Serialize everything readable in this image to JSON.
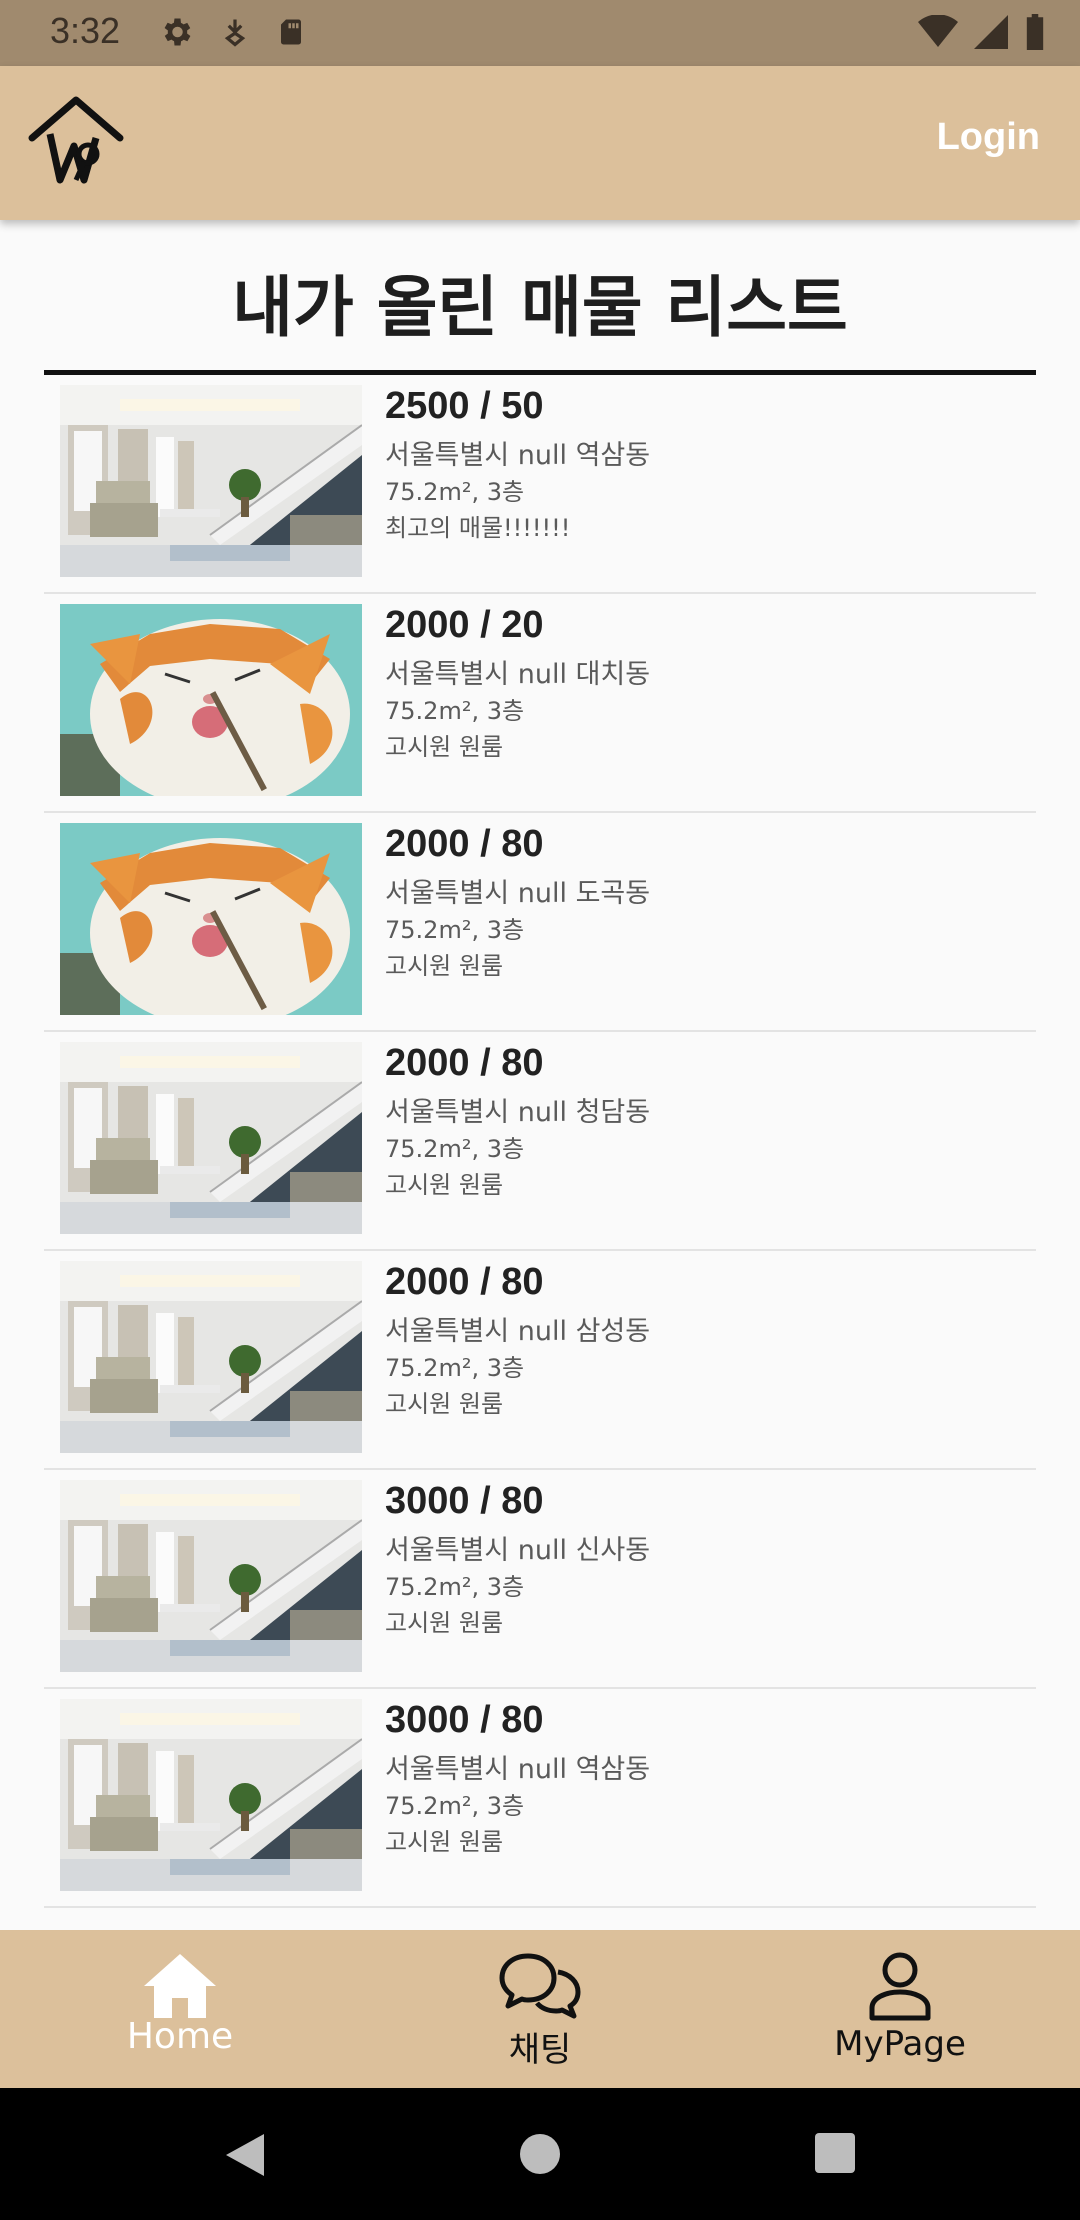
{
  "status_bar": {
    "time": "3:32",
    "icons_left": [
      "gear-icon",
      "download-icon",
      "sd-card-icon"
    ],
    "icons_right": [
      "wifi-icon",
      "signal-icon",
      "battery-icon"
    ]
  },
  "app_bar": {
    "logo": "house-key-logo",
    "login_label": "Login"
  },
  "page": {
    "title": "내가 올린 매물 리스트"
  },
  "listings": [
    {
      "thumb": "living-room-photo",
      "price": "2500 / 50",
      "address": "서울특별시 null 역삼동",
      "size": "75.2m², 3층",
      "desc": "최고의 매물!!!!!!!"
    },
    {
      "thumb": "cat-photo",
      "price": "2000 / 20",
      "address": "서울특별시 null 대치동",
      "size": "75.2m², 3층",
      "desc": "고시원 원룸"
    },
    {
      "thumb": "cat-photo",
      "price": "2000 / 80",
      "address": "서울특별시 null 도곡동",
      "size": "75.2m², 3층",
      "desc": "고시원 원룸"
    },
    {
      "thumb": "living-room-photo",
      "price": "2000 / 80",
      "address": "서울특별시 null 청담동",
      "size": "75.2m², 3층",
      "desc": "고시원 원룸"
    },
    {
      "thumb": "living-room-photo",
      "price": "2000 / 80",
      "address": "서울특별시 null 삼성동",
      "size": "75.2m², 3층",
      "desc": "고시원 원룸"
    },
    {
      "thumb": "living-room-photo",
      "price": "3000 / 80",
      "address": "서울특별시 null 신사동",
      "size": "75.2m², 3층",
      "desc": "고시원 원룸"
    },
    {
      "thumb": "living-room-photo",
      "price": "3000 / 80",
      "address": "서울특별시 null 역삼동",
      "size": "75.2m², 3층",
      "desc": "고시원 원룸"
    }
  ],
  "bottom_nav": {
    "items": [
      {
        "label": "Home",
        "icon": "home-icon",
        "active": true
      },
      {
        "label": "채팅",
        "icon": "chat-icon",
        "active": false
      },
      {
        "label": "MyPage",
        "icon": "person-icon",
        "active": false
      }
    ]
  },
  "system_nav": [
    "back-icon",
    "home-circle-icon",
    "recents-icon"
  ],
  "colors": {
    "status_bar": "#a08a6e",
    "app_bar": "#dcc09b",
    "active_nav": "#ffffff",
    "inactive_nav": "#111111"
  }
}
